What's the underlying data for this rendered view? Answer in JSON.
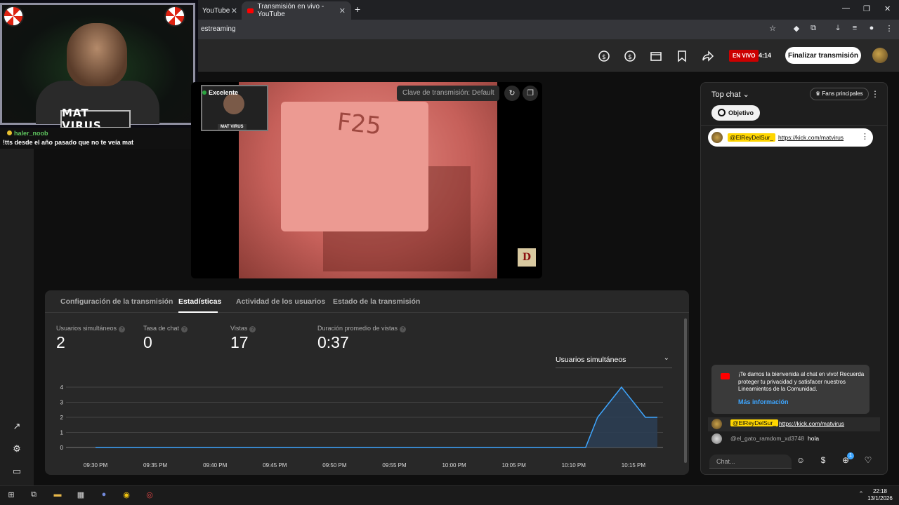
{
  "browser": {
    "tabs": [
      {
        "label": "YouTube"
      },
      {
        "label": "Transmisión en vivo - YouTube"
      }
    ],
    "url": "estreaming",
    "new_tab": "+",
    "close": "✕"
  },
  "header": {
    "live_badge": "EN VIVO",
    "live_time": "4:14",
    "end_button": "Finalizar transmisión"
  },
  "webcam": {
    "name_plate": "MAT VIRUS",
    "chat_user": "haler_noob",
    "chat_message": "!tts desde el año pasado que no te veía mat"
  },
  "preview": {
    "quality": "Excelente",
    "pip_label": "MAT VIRUS",
    "stream_key_placeholder": "Clave de transmisión: Default",
    "key_text": "F25",
    "logo_letter": "D"
  },
  "tabs": [
    {
      "label": "Configuración de la transmisión"
    },
    {
      "label": "Estadísticas"
    },
    {
      "label": "Actividad de los usuarios"
    },
    {
      "label": "Estado de la transmisión"
    }
  ],
  "active_tab": "Estadísticas",
  "stats": [
    {
      "label": "Usuarios simultáneos",
      "value": "2"
    },
    {
      "label": "Tasa de chat",
      "value": "0"
    },
    {
      "label": "Vistas",
      "value": "17"
    },
    {
      "label": "Duración promedio de vistas",
      "value": "0:37"
    }
  ],
  "metric_select": "Usuarios simultáneos",
  "chart_data": {
    "type": "area",
    "x": [
      "09:30 PM",
      "09:35 PM",
      "09:40 PM",
      "09:45 PM",
      "09:50 PM",
      "09:55 PM",
      "10:00 PM",
      "10:05 PM",
      "10:10 PM",
      "10:15 PM"
    ],
    "series": [
      {
        "points": [
          [
            0,
            0
          ],
          [
            8.2,
            0
          ],
          [
            8.4,
            2
          ],
          [
            8.8,
            4
          ],
          [
            9.2,
            2
          ],
          [
            9.4,
            2
          ]
        ]
      }
    ],
    "yticks": [
      0,
      1,
      2,
      3,
      4
    ],
    "ylim": [
      0,
      4
    ],
    "grid": true,
    "colors": {
      "line": "#3ea6ff",
      "fill": "#2c3e55"
    }
  },
  "chat": {
    "title": "Top chat",
    "fans_button": "Fans principales",
    "goal_button": "Objetivo",
    "pinned": {
      "author": "@ElReyDelSur_",
      "text": "https://kick.com/matvirus"
    },
    "welcome_text": "¡Te damos la bienvenida al chat en vivo! Recuerda proteger tu privacidad y satisfacer nuestros Lineamientos de la Comunidad.",
    "welcome_link": "Más información",
    "messages": [
      {
        "author": "@ElReyDelSur_",
        "text": "https://kick.com/matvirus"
      },
      {
        "author": "@el_gato_ramdom_xd3748",
        "text": "hola"
      }
    ],
    "input_placeholder": "Chat...",
    "emoji_badge": "1"
  },
  "taskbar": {
    "time": "22:18",
    "date": "13/1/2026"
  }
}
